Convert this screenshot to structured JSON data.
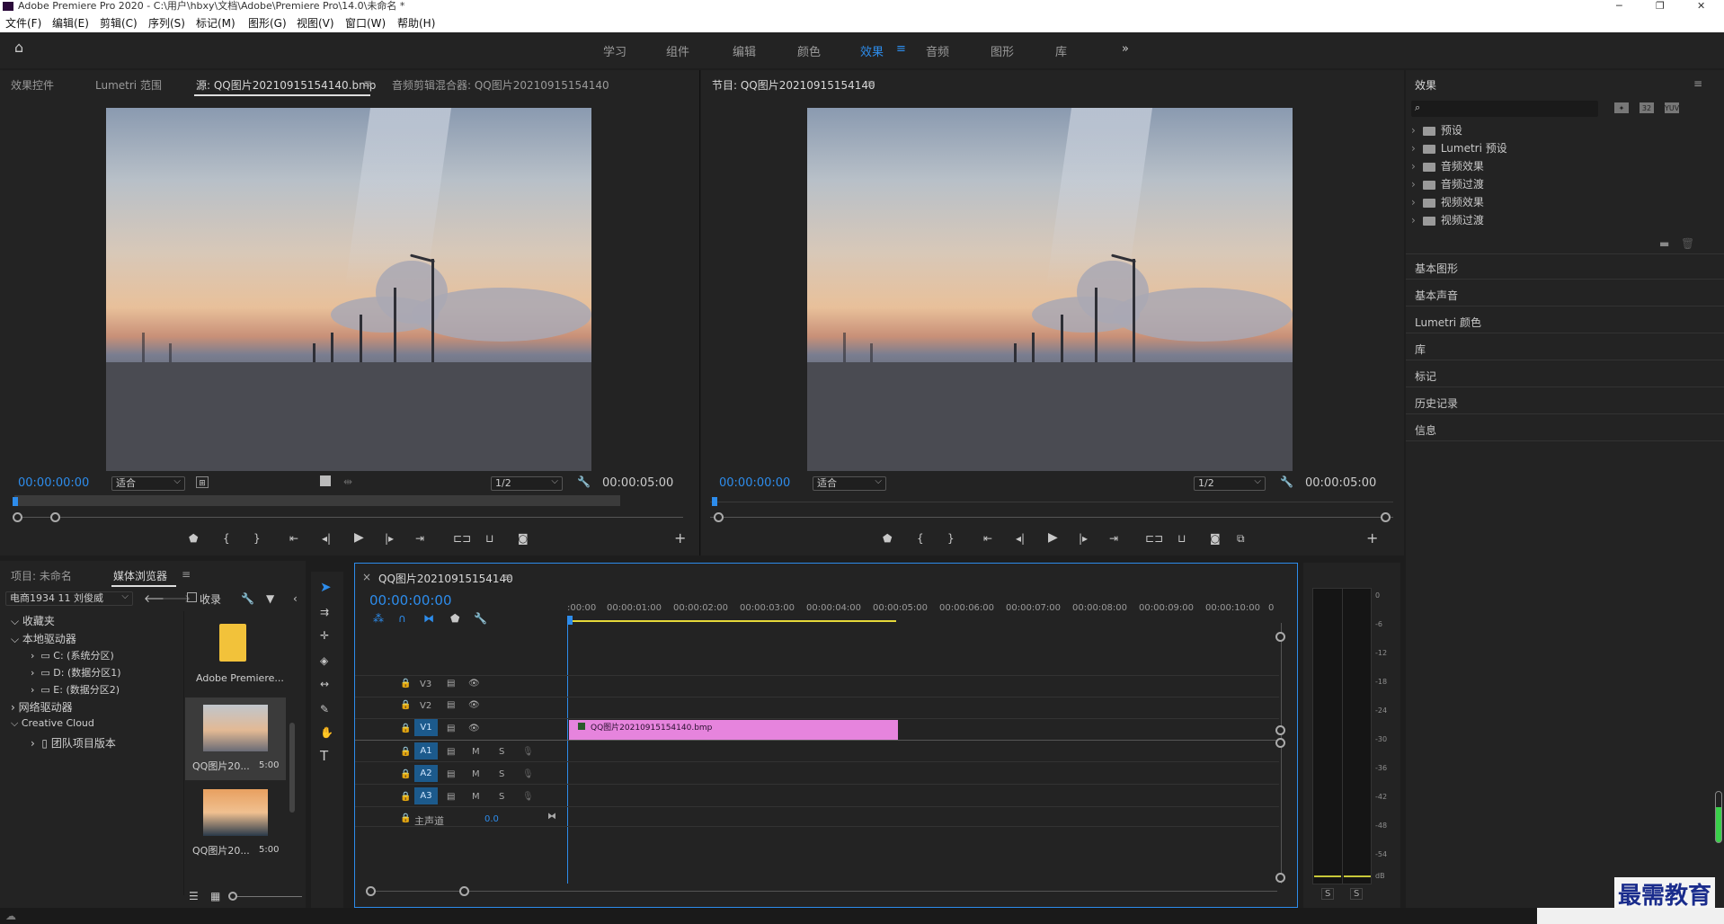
{
  "window": {
    "title": "Adobe Premiere Pro 2020 - C:\\用户\\hbxy\\文档\\Adobe\\Premiere Pro\\14.0\\未命名 *"
  },
  "menu": [
    "文件(F)",
    "编辑(E)",
    "剪辑(C)",
    "序列(S)",
    "标记(M)",
    "图形(G)",
    "视图(V)",
    "窗口(W)",
    "帮助(H)"
  ],
  "workspaces": {
    "items": [
      "学习",
      "组件",
      "编辑",
      "颜色",
      "效果",
      "音频",
      "图形",
      "库"
    ],
    "active": "效果",
    "more": "»"
  },
  "source_panel": {
    "tabs": [
      "效果控件",
      "Lumetri 范围",
      "源: QQ图片20210915154140.bmp",
      "音频剪辑混合器: QQ图片20210915154140"
    ],
    "active_tab": "源: QQ图片20210915154140.bmp",
    "timecode_in": "00:00:00:00",
    "fit": "适合",
    "resolution": "1/2",
    "duration": "00:00:05:00"
  },
  "program_panel": {
    "title": "节目: QQ图片20210915154140",
    "timecode_in": "00:00:00:00",
    "fit": "适合",
    "resolution": "1/2",
    "duration": "00:00:05:00"
  },
  "effects_panel": {
    "title": "效果",
    "search_placeholder": "",
    "items": [
      "预设",
      "Lumetri 预设",
      "音频效果",
      "音频过渡",
      "视频效果",
      "视频过渡"
    ],
    "sections": [
      "基本图形",
      "基本声音",
      "Lumetri 颜色",
      "库",
      "标记",
      "历史记录",
      "信息"
    ]
  },
  "project_panel": {
    "tabs": [
      "项目: 未命名",
      "媒体浏览器"
    ],
    "active_tab": "媒体浏览器",
    "location": "电商1934 11 刘俊威",
    "collect_label": "收录",
    "tree": {
      "favorites": "收藏夹",
      "local": "本地驱动器",
      "drives": [
        "C: (系统分区)",
        "D: (数据分区1)",
        "E: (数据分区2)"
      ],
      "network": "网络驱动器",
      "cloud": "Creative Cloud",
      "team": "团队项目版本"
    },
    "thumbs": [
      {
        "name": "Adobe Premiere...",
        "duration": ""
      },
      {
        "name": "QQ图片20...",
        "duration": "5:00"
      },
      {
        "name": "QQ图片20...",
        "duration": "5:00"
      }
    ]
  },
  "timeline": {
    "title": "QQ图片20210915154140",
    "timecode": "00:00:00:00",
    "ruler": [
      ":00:00",
      "00:00:01:00",
      "00:00:02:00",
      "00:00:03:00",
      "00:00:04:00",
      "00:00:05:00",
      "00:00:06:00",
      "00:00:07:00",
      "00:00:08:00",
      "00:00:09:00",
      "00:00:10:00",
      "0"
    ],
    "video_tracks": [
      "V3",
      "V2",
      "V1"
    ],
    "audio_tracks": [
      "A1",
      "A2",
      "A3"
    ],
    "master_label": "主声道",
    "master_value": "0.0",
    "clip_name": "QQ图片20210915154140.bmp",
    "mute_label": "M",
    "solo_label": "S"
  },
  "meter": {
    "labels": [
      "0",
      "-6",
      "-12",
      "-18",
      "-24",
      "-30",
      "-36",
      "-42",
      "-48",
      "-54",
      "dB"
    ],
    "solo": [
      "S",
      "S"
    ]
  },
  "watermark": "最需教育",
  "colors": {
    "accent": "#2d8ceb",
    "clip": "#e684dd",
    "panel": "#232323"
  }
}
